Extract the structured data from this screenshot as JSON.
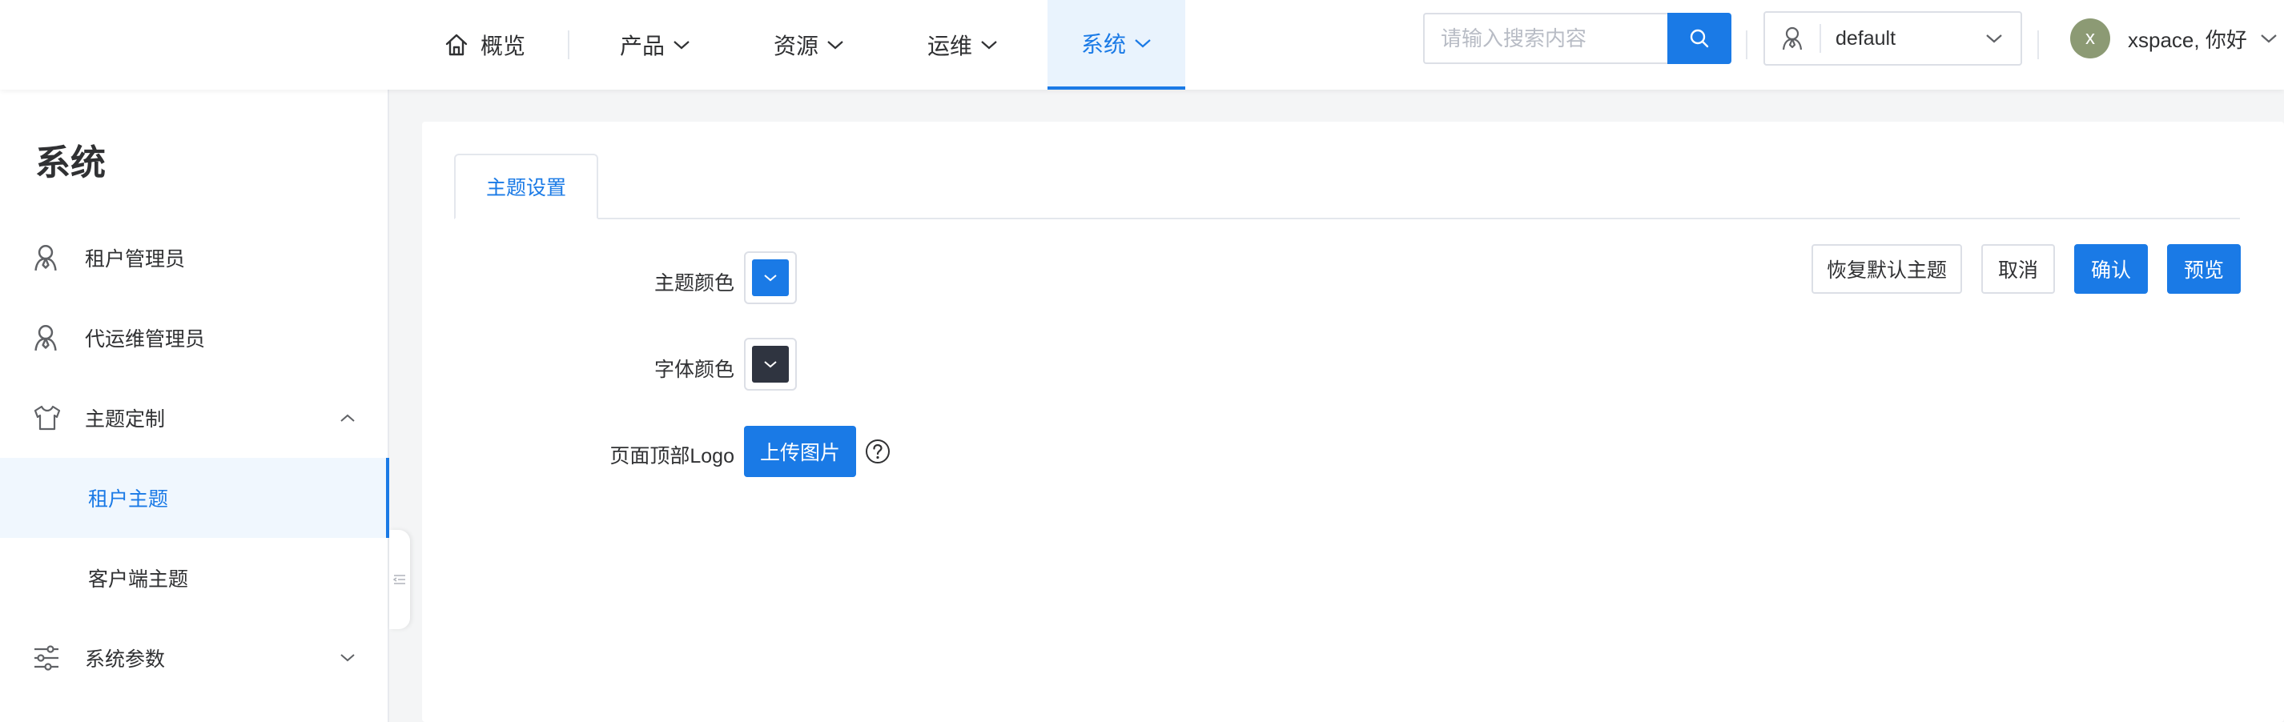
{
  "header": {
    "nav": [
      {
        "label": "概览",
        "icon": "home-icon"
      },
      {
        "label": "产品"
      },
      {
        "label": "资源"
      },
      {
        "label": "运维"
      },
      {
        "label": "系统",
        "active": true
      }
    ],
    "search": {
      "placeholder": "请输入搜索内容"
    },
    "tenant": {
      "value": "default"
    },
    "user": {
      "avatar_letter": "x",
      "greeting": "xspace, 你好"
    }
  },
  "sidebar": {
    "title": "系统",
    "items": [
      {
        "label": "租户管理员",
        "icon": "user-icon"
      },
      {
        "label": "代运维管理员",
        "icon": "user-icon"
      },
      {
        "label": "主题定制",
        "icon": "shirt-icon",
        "expanded": true,
        "children": [
          {
            "label": "租户主题",
            "active": true
          },
          {
            "label": "客户端主题"
          }
        ]
      },
      {
        "label": "系统参数",
        "icon": "sliders-icon",
        "expanded": false
      }
    ]
  },
  "main": {
    "tabs": [
      {
        "label": "主题设置",
        "active": true
      }
    ],
    "form": {
      "theme_color_label": "主题颜色",
      "font_color_label": "字体颜色",
      "logo_label": "页面顶部Logo",
      "upload_label": "上传图片"
    },
    "actions": {
      "reset_label": "恢复默认主题",
      "cancel_label": "取消",
      "confirm_label": "确认",
      "preview_label": "预览"
    }
  },
  "colors": {
    "accent": "#1a7ae6",
    "theme_color": "#1a7ae6",
    "font_color": "#2f3440",
    "avatar": "#8c9a74"
  }
}
